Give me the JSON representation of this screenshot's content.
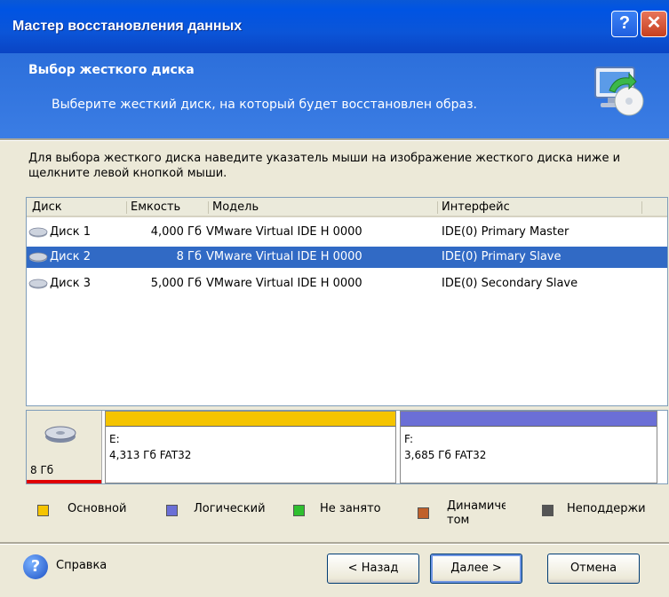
{
  "window": {
    "title": "Мастер восстановления данных",
    "help_glyph": "?",
    "close_glyph": "✕"
  },
  "header": {
    "title": "Выбор жесткого диска",
    "subtitle": "Выберите жесткий диск, на который будет восстановлен образ.",
    "icon": "restore-wizard-icon"
  },
  "instruction": "Для выбора жесткого диска наведите указатель мыши на изображение жесткого диска ниже и щелкните левой кнопкой мыши.",
  "table": {
    "columns": [
      "Диск",
      "Емкость",
      "Модель",
      "Интерфейс"
    ],
    "rows": [
      {
        "disk": "Диск 1",
        "capacity": "4,000 Гб",
        "model": "VMware Virtual IDE H 0000",
        "interface": "IDE(0) Primary Master",
        "selected": false
      },
      {
        "disk": "Диск 2",
        "capacity": "8 Гб",
        "model": "VMware Virtual IDE H 0000",
        "interface": "IDE(0) Primary Slave",
        "selected": true
      },
      {
        "disk": "Диск 3",
        "capacity": "5,000 Гб",
        "model": "VMware Virtual IDE H 0000",
        "interface": "IDE(0) Secondary Slave",
        "selected": false
      }
    ]
  },
  "disk_map": {
    "disk_label": "8 Гб",
    "partitions": [
      {
        "letter": "E:",
        "info": "4,313 Гб  FAT32",
        "type_color": "#f5c400"
      },
      {
        "letter": "F:",
        "info": "3,685 Гб  FAT32",
        "type_color": "#6b6fd6"
      }
    ]
  },
  "legend": [
    {
      "label": "Основной",
      "color": "#f5c400"
    },
    {
      "label": "Логический",
      "color": "#6b6fd6"
    },
    {
      "label": "Не занято",
      "color": "#2fbf2f"
    },
    {
      "label": "Динамически",
      "label2": "том",
      "color": "#c0602a"
    },
    {
      "label": "Неподдержи",
      "color": "#555555"
    }
  ],
  "footer": {
    "help": "Справка",
    "back": "< Назад",
    "next": "Далее >",
    "cancel": "Отмена"
  }
}
